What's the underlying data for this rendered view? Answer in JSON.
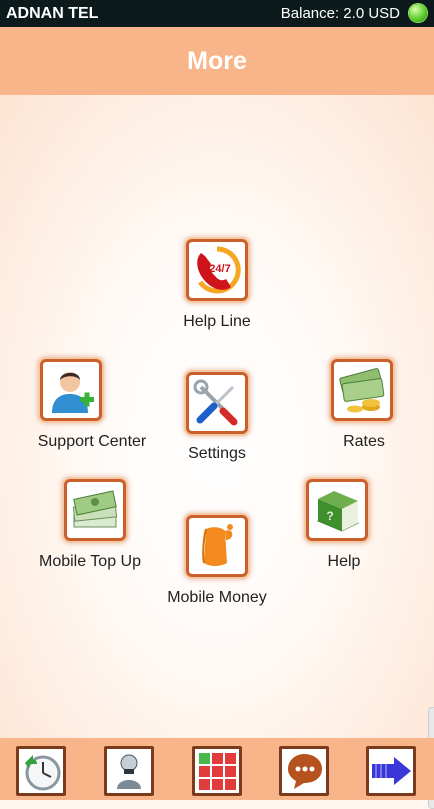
{
  "status_bar": {
    "app_name": "ADNAN TEL",
    "balance": "Balance: 2.0 USD",
    "status_icon": "green-status-dot-icon"
  },
  "header": {
    "title": "More"
  },
  "menu": {
    "help_line": {
      "label": "Help Line",
      "badge": "24/7",
      "icon": "phone-247-icon"
    },
    "support_center": {
      "label": "Support Center",
      "icon": "user-add-icon"
    },
    "settings": {
      "label": "Settings",
      "icon": "tools-icon"
    },
    "rates": {
      "label": "Rates",
      "icon": "money-coins-icon"
    },
    "mobile_top_up": {
      "label": "Mobile Top Up",
      "icon": "cash-stack-icon"
    },
    "help": {
      "label": "Help",
      "icon": "book-icon"
    },
    "mobile_money": {
      "label": "Mobile Money",
      "icon": "mobile-money-icon"
    }
  },
  "bottom_nav": [
    {
      "name": "history",
      "icon": "clock-icon"
    },
    {
      "name": "contacts",
      "icon": "person-icon"
    },
    {
      "name": "dialpad",
      "icon": "grid-icon"
    },
    {
      "name": "messages",
      "icon": "chat-icon"
    },
    {
      "name": "more",
      "icon": "arrow-right-icon"
    }
  ],
  "colors": {
    "header": "#f9b58a",
    "status_bar": "#0d1a1c",
    "tile_border": "#c9602c"
  }
}
